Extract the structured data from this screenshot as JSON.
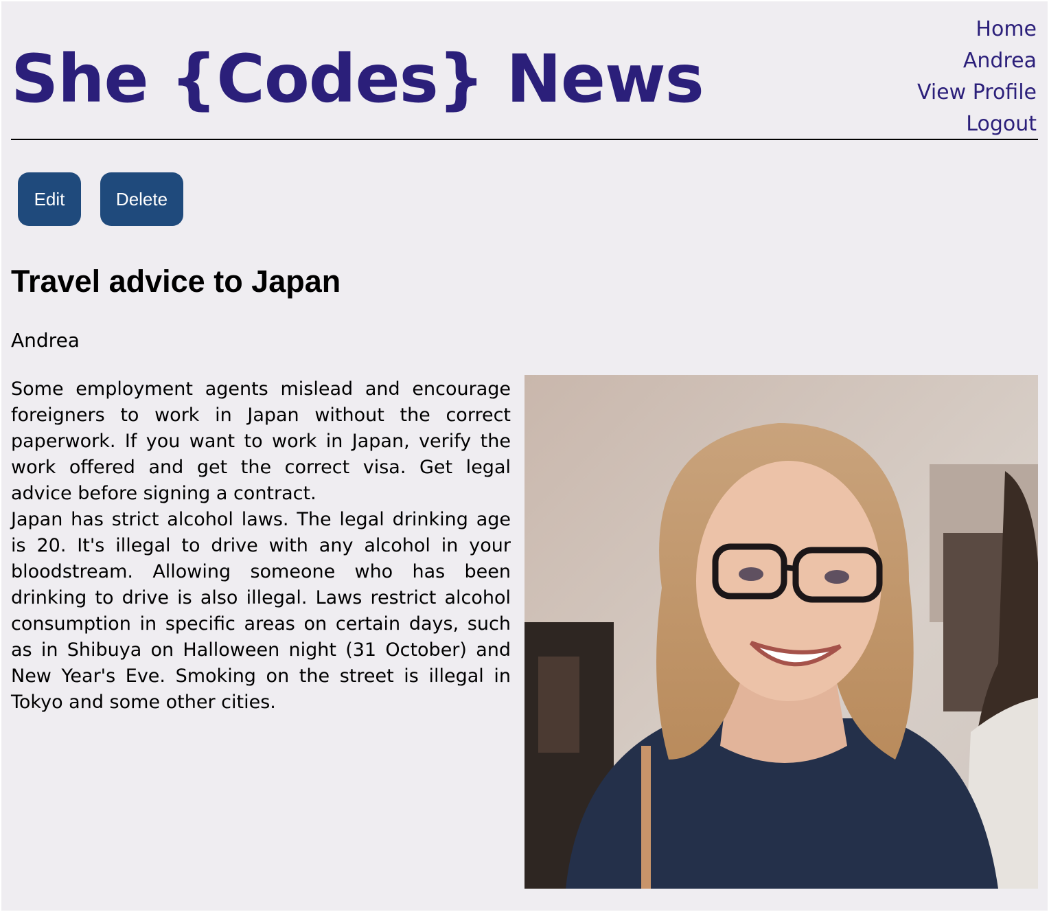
{
  "header": {
    "site_title": "She {Codes} News",
    "nav": [
      {
        "label": "Home"
      },
      {
        "label": "Andrea"
      },
      {
        "label": "View Profile"
      },
      {
        "label": "Logout"
      }
    ]
  },
  "actions": {
    "edit_label": "Edit",
    "delete_label": "Delete"
  },
  "story": {
    "title": "Travel advice to Japan",
    "author": "Andrea",
    "paragraphs": [
      "Some employment agents mislead and encourage foreigners to work in Japan without the correct paperwork. If you want to work in Japan, verify the work offered and get the correct visa. Get legal advice before signing a contract.",
      "Japan has strict alcohol laws. The legal drinking age is 20. It's illegal to drive with any alcohol in your bloodstream. Allowing someone who has been drinking to drive is also illegal. Laws restrict alcohol consumption in specific areas on certain days, such as in Shibuya on Halloween night (31 October) and New Year's Eve. Smoking on the street is illegal in Tokyo and some other cities."
    ]
  },
  "colors": {
    "background": "#efedf1",
    "brand": "#2b1f7a",
    "button": "#1f4a7c"
  }
}
